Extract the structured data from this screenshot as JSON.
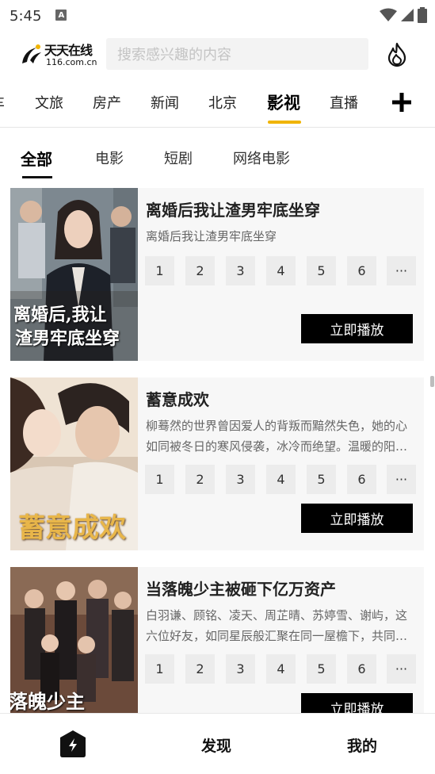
{
  "status_bar": {
    "time": "5:45",
    "notification_icon": "A"
  },
  "header": {
    "logo_main": "天天在线",
    "logo_sub": "116.com.cn",
    "search_placeholder": "搜索感兴趣的内容",
    "hot_icon": "flame-icon"
  },
  "category_tabs": {
    "items": [
      "车",
      "文旅",
      "房产",
      "新闻",
      "北京",
      "影视",
      "直播"
    ],
    "active": "影视"
  },
  "sub_tabs": {
    "items": [
      "全部",
      "电影",
      "短剧",
      "网络电影"
    ],
    "active": "全部"
  },
  "episodes": [
    "1",
    "2",
    "3",
    "4",
    "5",
    "6",
    "···"
  ],
  "play_label": "立即播放",
  "videos": [
    {
      "title": "离婚后我让渣男牢底坐穿",
      "desc": "离婚后我让渣男牢底坐穿",
      "poster_text_1": "离婚后,我让",
      "poster_text_2": "渣男牢底坐穿"
    },
    {
      "title": "蓄意成欢",
      "desc": "柳蓦然的世界曾因爱人的背叛而黯然失色，她的心如同被冬日的寒风侵袭，冰冷而绝望。温暖的阳光和希望仿佛离她远去……",
      "poster_text_1": "蓄意成欢"
    },
    {
      "title": "当落魄少主被砸下亿万资产",
      "desc": "白羽谦、顾铭、凌天、周芷晴、苏婷雪、谢屿，这六位好友，如同星辰般汇聚在同一屋檐下，共同经历着人生的起伏……",
      "poster_text_1": "落魄少主"
    }
  ],
  "bottom_nav": {
    "home_icon": "home-icon",
    "discover": "发现",
    "mine": "我的"
  },
  "colors": {
    "accent": "#f0b400",
    "button": "#000000"
  }
}
